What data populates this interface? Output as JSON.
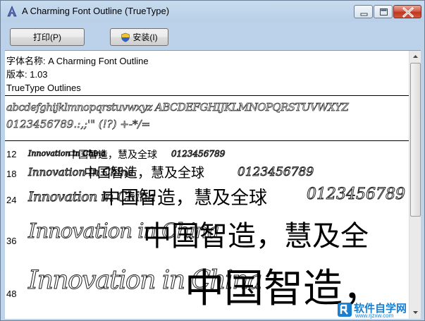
{
  "window": {
    "title": "A Charming Font Outline (TrueType)",
    "close_color": "#c2361f"
  },
  "toolbar": {
    "print_label": "打印(P)",
    "install_label": "安装(I)"
  },
  "info": {
    "font_name_line": "字体名称: A Charming Font Outline",
    "version_line": "版本: 1.03",
    "type_line": "TrueType Outlines"
  },
  "charset": {
    "row1": "abcdefghijklmnopqrstuvwxyz ABCDEFGHIJKLMNOPQRSTUVWXYZ",
    "row2": "0123456789.:,;'\" (!?) +-*/="
  },
  "samples": [
    {
      "size": "12",
      "latin": "Innovation in China",
      "cjk": "中国智造，慧及全球",
      "digits": "0123456789"
    },
    {
      "size": "18",
      "latin": "Innovation in China",
      "cjk": "中国智造，慧及全球",
      "digits": "0123456789"
    },
    {
      "size": "24",
      "latin": "Innovation in China",
      "cjk": "中国智造，慧及全球",
      "digits": "0123456789"
    },
    {
      "size": "36",
      "latin": "Innovation in China",
      "cjk": "中国智造，慧及全",
      "digits": ""
    },
    {
      "size": "48",
      "latin": "Innovation in China",
      "cjk": "中国智造，",
      "digits": ""
    }
  ],
  "watermark": {
    "brand": "软件自学网",
    "url": "www.rjzxw.com"
  }
}
